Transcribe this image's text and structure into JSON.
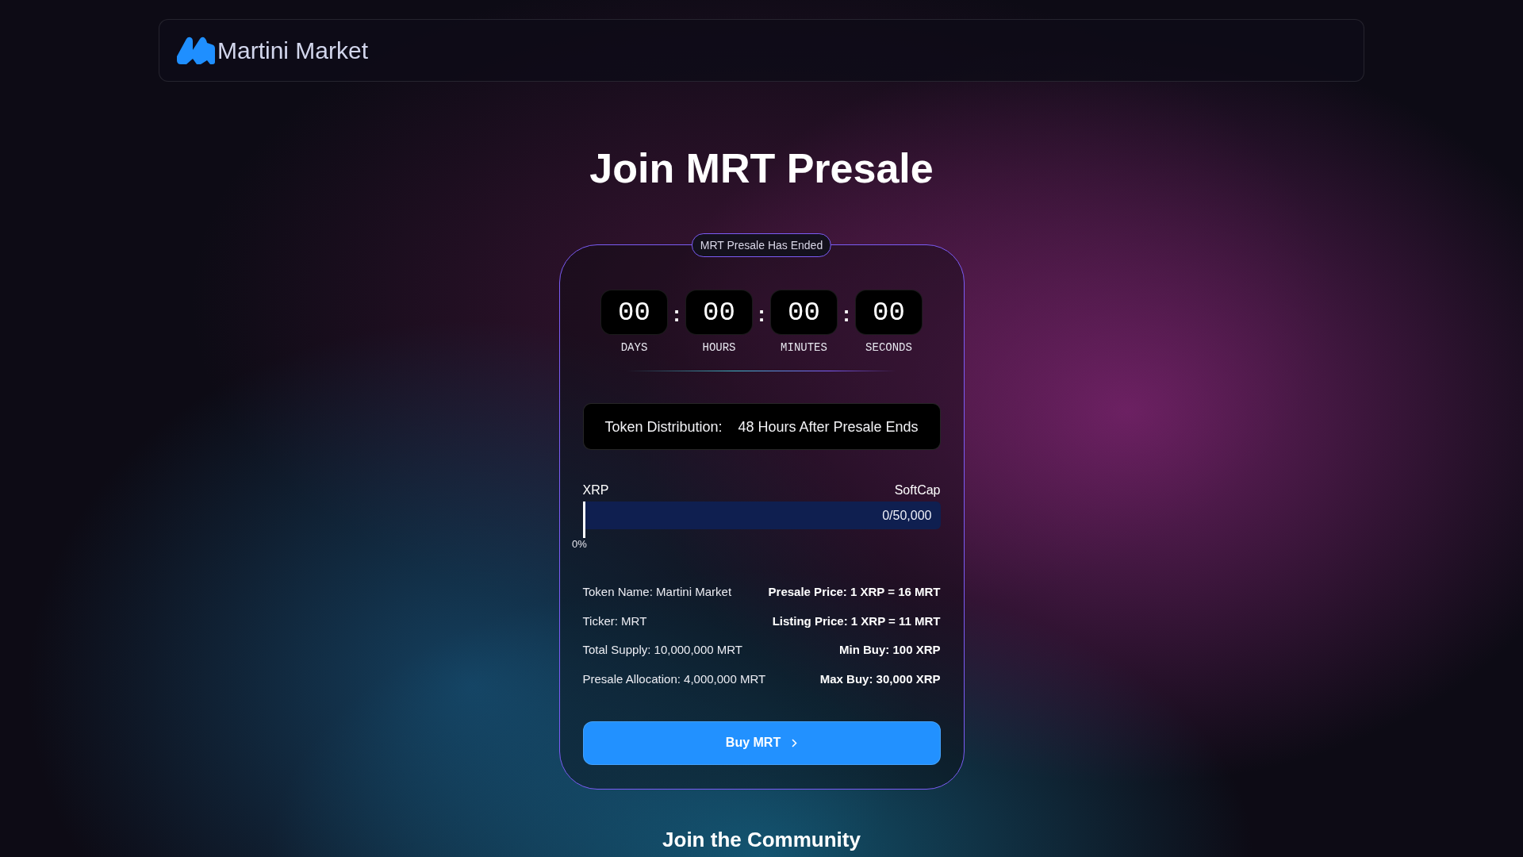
{
  "header": {
    "brand": "Martini Market"
  },
  "title": "Join MRT Presale",
  "presale_card": {
    "status_badge": "MRT Presale Has Ended",
    "countdown": [
      {
        "value": "00",
        "label": "DAYS"
      },
      {
        "value": "00",
        "label": "HOURS"
      },
      {
        "value": "00",
        "label": "MINUTES"
      },
      {
        "value": "00",
        "label": "SECONDS"
      }
    ],
    "countdown_separators": [
      ":",
      ":",
      ":"
    ],
    "distribution": {
      "label": "Token Distribution:",
      "value": "48 Hours After Presale Ends"
    },
    "progress": {
      "currency": "XRP",
      "target_label": "SoftCap",
      "amount": "0/50,000",
      "level": 0,
      "percent": "0%"
    },
    "token_facts": [
      "Token Name: Martini Market",
      "Ticker: MRT",
      "Total Supply: 10,000,000 MRT",
      "Presale Allocation: 4,000,000 MRT"
    ],
    "sale_terms": [
      "Presale Price: 1 XRP = 16 MRT",
      "Listing Price: 1 XRP = 11 MRT",
      "Min Buy: 100 XRP",
      "Max Buy: 30,000 XRP"
    ],
    "buy_button": {
      "label": "Buy MRT"
    }
  },
  "community_heading": "Join the Community"
}
